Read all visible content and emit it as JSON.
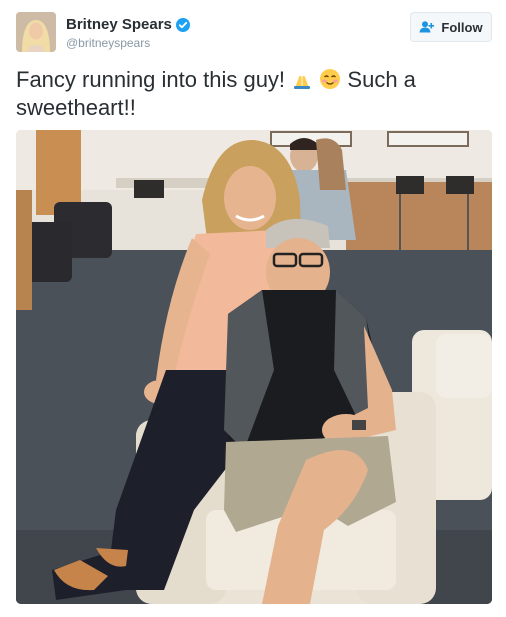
{
  "tweet": {
    "display_name": "Britney Spears",
    "handle": "@britneyspears",
    "follow_label": "Follow",
    "text_part1": "Fancy running into this guy!",
    "text_part2": "Such a sweetheart!!",
    "emojis": [
      "folded-hands-emoji",
      "smiling-face-emoji"
    ]
  },
  "colors": {
    "verified_blue": "#1da1f2",
    "follow_icon_blue": "#1b95e0",
    "text": "#292f33",
    "handle_gray": "#8899a6"
  }
}
